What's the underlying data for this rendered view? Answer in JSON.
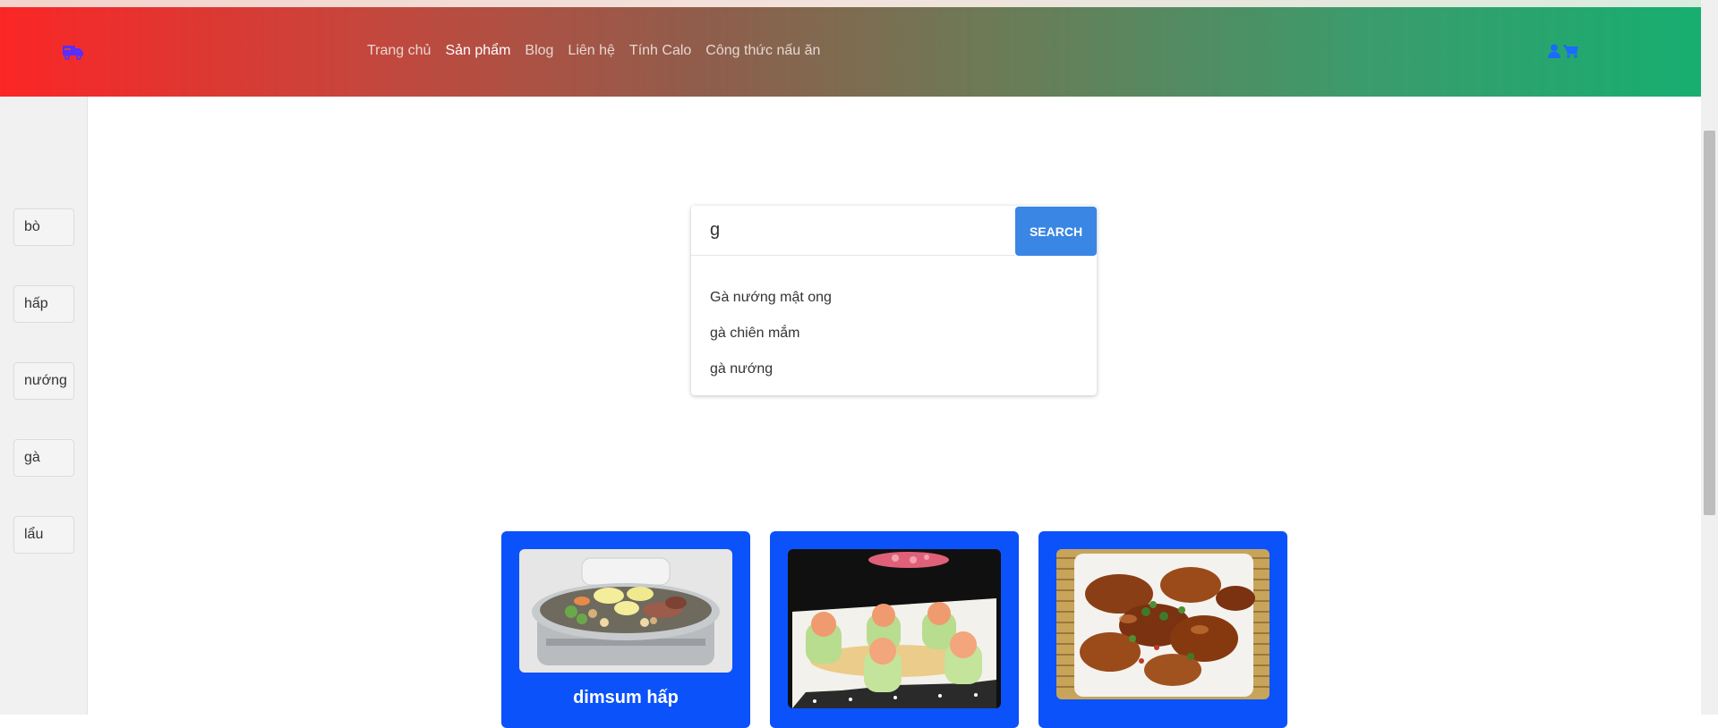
{
  "header": {
    "nav": [
      {
        "label": "Trang chủ",
        "active": false
      },
      {
        "label": "Sản phẩm",
        "active": true
      },
      {
        "label": "Blog",
        "active": false
      },
      {
        "label": "Liên hệ",
        "active": false
      },
      {
        "label": "Tính Calo",
        "active": false
      },
      {
        "label": "Công thức nấu ăn",
        "active": false
      }
    ],
    "icons": [
      "truck-icon",
      "user-icon",
      "cart-icon"
    ],
    "colors": {
      "gradient_start": "#fb2626",
      "gradient_end": "#17ae70",
      "icon_color": "#1a6bff",
      "logo_color": "#5a2dff"
    }
  },
  "sidebar": {
    "tags": [
      "bò",
      "hấp",
      "nướng",
      "gà",
      "lẩu"
    ]
  },
  "search": {
    "value": "g",
    "button_label": "SEARCH",
    "suggestions": [
      "Gà nướng mật ong",
      "gà chiên mắm",
      "gà nướng"
    ],
    "button_color": "#3a86e4"
  },
  "products": [
    {
      "title": "dimsum hấp",
      "image": "steamed-dimsum-photo"
    },
    {
      "title": "",
      "image": "stuffed-cucumber-shrimp-photo"
    },
    {
      "title": "",
      "image": "glazed-chicken-wings-photo"
    }
  ],
  "card_color": "#0b52fb"
}
